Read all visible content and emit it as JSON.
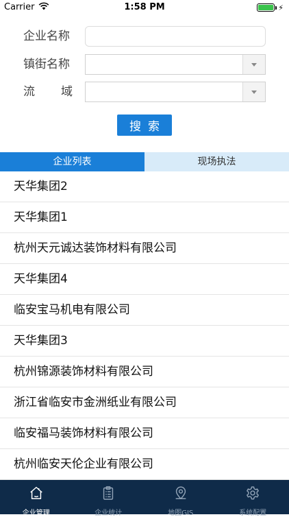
{
  "status_bar": {
    "carrier": "Carrier",
    "time": "1:58 PM"
  },
  "form": {
    "company_name_label": "企业名称",
    "company_name_value": "",
    "town_label": "镇街名称",
    "town_value": "",
    "basin_label_chars": [
      "流",
      "域"
    ],
    "basin_value": "",
    "search_label": "搜索"
  },
  "tabs": [
    {
      "label": "企业列表",
      "active": true
    },
    {
      "label": "现场执法",
      "active": false
    }
  ],
  "companies": [
    "天华集团2",
    "天华集团1",
    "杭州天元诚达装饰材料有限公司",
    "天华集团4",
    "临安宝马机电有限公司",
    "天华集团3",
    "杭州锦源装饰材料有限公司",
    "浙江省临安市金洲纸业有限公司",
    "临安福马装饰材料有限公司",
    "杭州临安天伦企业有限公司"
  ],
  "tabbar": [
    {
      "label": "企业管理",
      "icon": "house-icon",
      "active": true
    },
    {
      "label": "企业统计",
      "icon": "clipboard-icon",
      "active": false
    },
    {
      "label": "地图GIS",
      "icon": "map-pin-icon",
      "active": false
    },
    {
      "label": "系统配置",
      "icon": "gear-icon",
      "active": false
    }
  ],
  "colors": {
    "accent": "#1a7fd8",
    "tab_inactive": "#d8ebf9",
    "tabbar_bg": "#0f2b49",
    "battery": "#3ac34b"
  }
}
